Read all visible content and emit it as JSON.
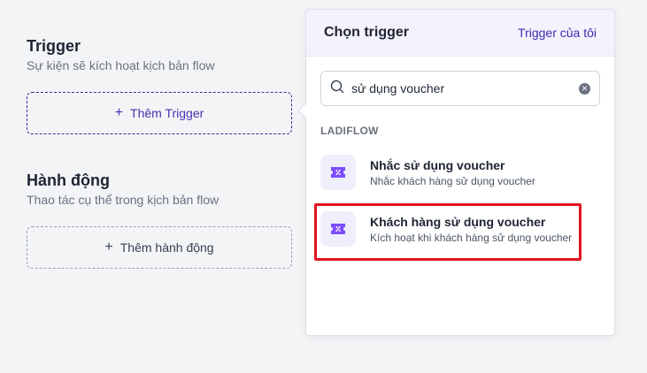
{
  "trigger_section": {
    "title": "Trigger",
    "description": "Sự kiện sẽ kích hoạt kịch bản flow",
    "add_label": "Thêm Trigger"
  },
  "action_section": {
    "title": "Hành động",
    "description": "Thao tác cụ thể trong kịch bản flow",
    "add_label": "Thêm hành động"
  },
  "panel": {
    "title": "Chọn trigger",
    "link": "Trigger của tôi",
    "search": {
      "value": "sử dụng voucher",
      "placeholder": ""
    },
    "group_label": "LADIFLOW",
    "items": [
      {
        "title": "Nhắc sử dụng voucher",
        "subtitle": "Nhắc khách hàng sử dụng voucher",
        "icon": "voucher-ticket-icon"
      },
      {
        "title": "Khách hàng sử dụng voucher",
        "subtitle": "Kích hoạt khi khách hàng sử dụng voucher",
        "icon": "voucher-ticket-icon",
        "highlighted": true
      }
    ]
  },
  "colors": {
    "accent": "#4b2fb0",
    "icon_bg": "#efeefb",
    "icon_fill": "#7c4dff",
    "highlight": "#e0141f"
  }
}
